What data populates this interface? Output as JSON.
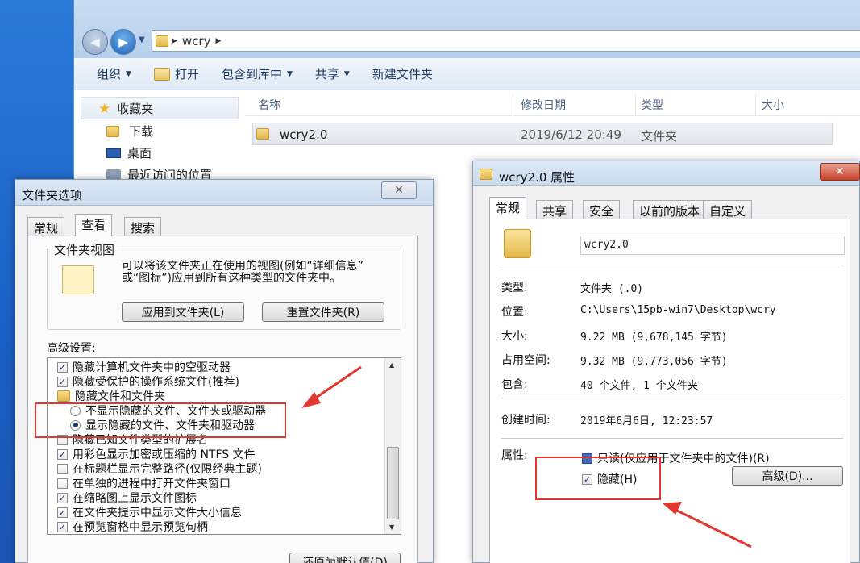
{
  "explorer": {
    "address": {
      "segments": [
        "wcry"
      ]
    },
    "toolbar": [
      {
        "label": "组织",
        "dropdown": true
      },
      {
        "label": "打开",
        "dropdown": false
      },
      {
        "label": "包含到库中",
        "dropdown": true
      },
      {
        "label": "共享",
        "dropdown": true
      },
      {
        "label": "新建文件夹",
        "dropdown": false
      }
    ],
    "nav": {
      "favorites": "收藏夹",
      "downloads": "下载",
      "desktop": "桌面",
      "recent": "最近访问的位置"
    },
    "columns": {
      "name": "名称",
      "modified": "修改日期",
      "type": "类型",
      "size": "大小"
    },
    "rows": [
      {
        "name": "wcry2.0",
        "modified": "2019/6/12 20:49",
        "type": "文件夹",
        "size": ""
      }
    ]
  },
  "folder_options": {
    "title": "文件夹选项",
    "close": "✕",
    "tabs": [
      "常规",
      "查看",
      "搜索"
    ],
    "active_tab": "查看",
    "folder_view": {
      "legend": "文件夹视图",
      "desc_line1": "可以将该文件夹正在使用的视图(例如“详细信息”",
      "desc_line2": "或“图标”)应用到所有这种类型的文件夹中。",
      "apply_button": "应用到文件夹(L)",
      "reset_button": "重置文件夹(R)"
    },
    "advanced_label": "高级设置:",
    "items": [
      {
        "kind": "check",
        "checked": true,
        "indent": 0,
        "label": "隐藏计算机文件夹中的空驱动器"
      },
      {
        "kind": "check",
        "checked": true,
        "indent": 0,
        "label": "隐藏受保护的操作系统文件(推荐)"
      },
      {
        "kind": "folder",
        "indent": 0,
        "label": "隐藏文件和文件夹"
      },
      {
        "kind": "radio",
        "checked": false,
        "indent": 1,
        "label": "不显示隐藏的文件、文件夹或驱动器"
      },
      {
        "kind": "radio",
        "checked": true,
        "indent": 1,
        "label": "显示隐藏的文件、文件夹和驱动器"
      },
      {
        "kind": "check",
        "checked": false,
        "indent": 0,
        "label": "隐藏已知文件类型的扩展名"
      },
      {
        "kind": "check",
        "checked": true,
        "indent": 0,
        "label": "用彩色显示加密或压缩的 NTFS 文件"
      },
      {
        "kind": "check",
        "checked": false,
        "indent": 0,
        "label": "在标题栏显示完整路径(仅限经典主题)"
      },
      {
        "kind": "check",
        "checked": false,
        "indent": 0,
        "label": "在单独的进程中打开文件夹窗口"
      },
      {
        "kind": "check",
        "checked": true,
        "indent": 0,
        "label": "在缩略图上显示文件图标"
      },
      {
        "kind": "check",
        "checked": true,
        "indent": 0,
        "label": "在文件夹提示中显示文件大小信息"
      },
      {
        "kind": "check",
        "checked": true,
        "indent": 0,
        "label": "在预览窗格中显示预览句柄"
      }
    ],
    "restore_button": "还原为默认值(D)"
  },
  "properties": {
    "title": "wcry2.0 属性",
    "close": "✕",
    "tabs": [
      "常规",
      "共享",
      "安全",
      "以前的版本",
      "自定义"
    ],
    "active_tab": "常规",
    "name_value": "wcry2.0",
    "fields": [
      {
        "label": "类型:",
        "value": "文件夹 (.0)"
      },
      {
        "label": "位置:",
        "value": "C:\\Users\\15pb-win7\\Desktop\\wcry"
      },
      {
        "label": "大小:",
        "value": "9.22 MB (9,678,145 字节)"
      },
      {
        "label": "占用空间:",
        "value": "9.32 MB (9,773,056 字节)"
      },
      {
        "label": "包含:",
        "value": "40 个文件, 1 个文件夹"
      }
    ],
    "created_label": "创建时间:",
    "created_value": "2019年6月6日, 12:23:57",
    "attributes_label": "属性:",
    "readonly_label": "只读(仅应用于文件夹中的文件)(R)",
    "hidden_label": "隐藏(H)",
    "hidden_checked": true,
    "advanced_button": "高级(D)..."
  },
  "colors": {
    "annotation": "#e2372f",
    "desktop": "#1e66c9"
  }
}
